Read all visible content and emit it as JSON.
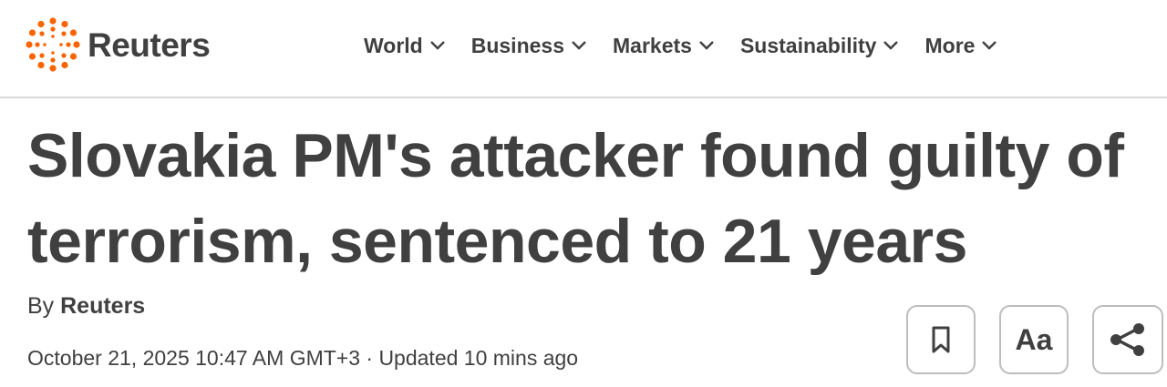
{
  "brand": {
    "name": "Reuters",
    "accent_color": "#fa6400"
  },
  "nav": {
    "items": [
      {
        "label": "World",
        "icon": "chevron-down-icon"
      },
      {
        "label": "Business",
        "icon": "chevron-down-icon"
      },
      {
        "label": "Markets",
        "icon": "chevron-down-icon"
      },
      {
        "label": "Sustainability",
        "icon": "chevron-down-icon"
      },
      {
        "label": "More",
        "icon": "chevron-down-icon"
      }
    ]
  },
  "article": {
    "headline_line1": "Slovakia PM's attacker found guilty of",
    "headline_line2": "terrorism, sentenced to 21 years",
    "byline_prefix": "By ",
    "author": "Reuters",
    "dateline": "October 21, 2025 10:47 AM GMT+3 · Updated 10 mins ago"
  },
  "tools": {
    "bookmark_icon": "bookmark-icon",
    "text_size_label": "Aa",
    "share_icon": "share-icon"
  }
}
